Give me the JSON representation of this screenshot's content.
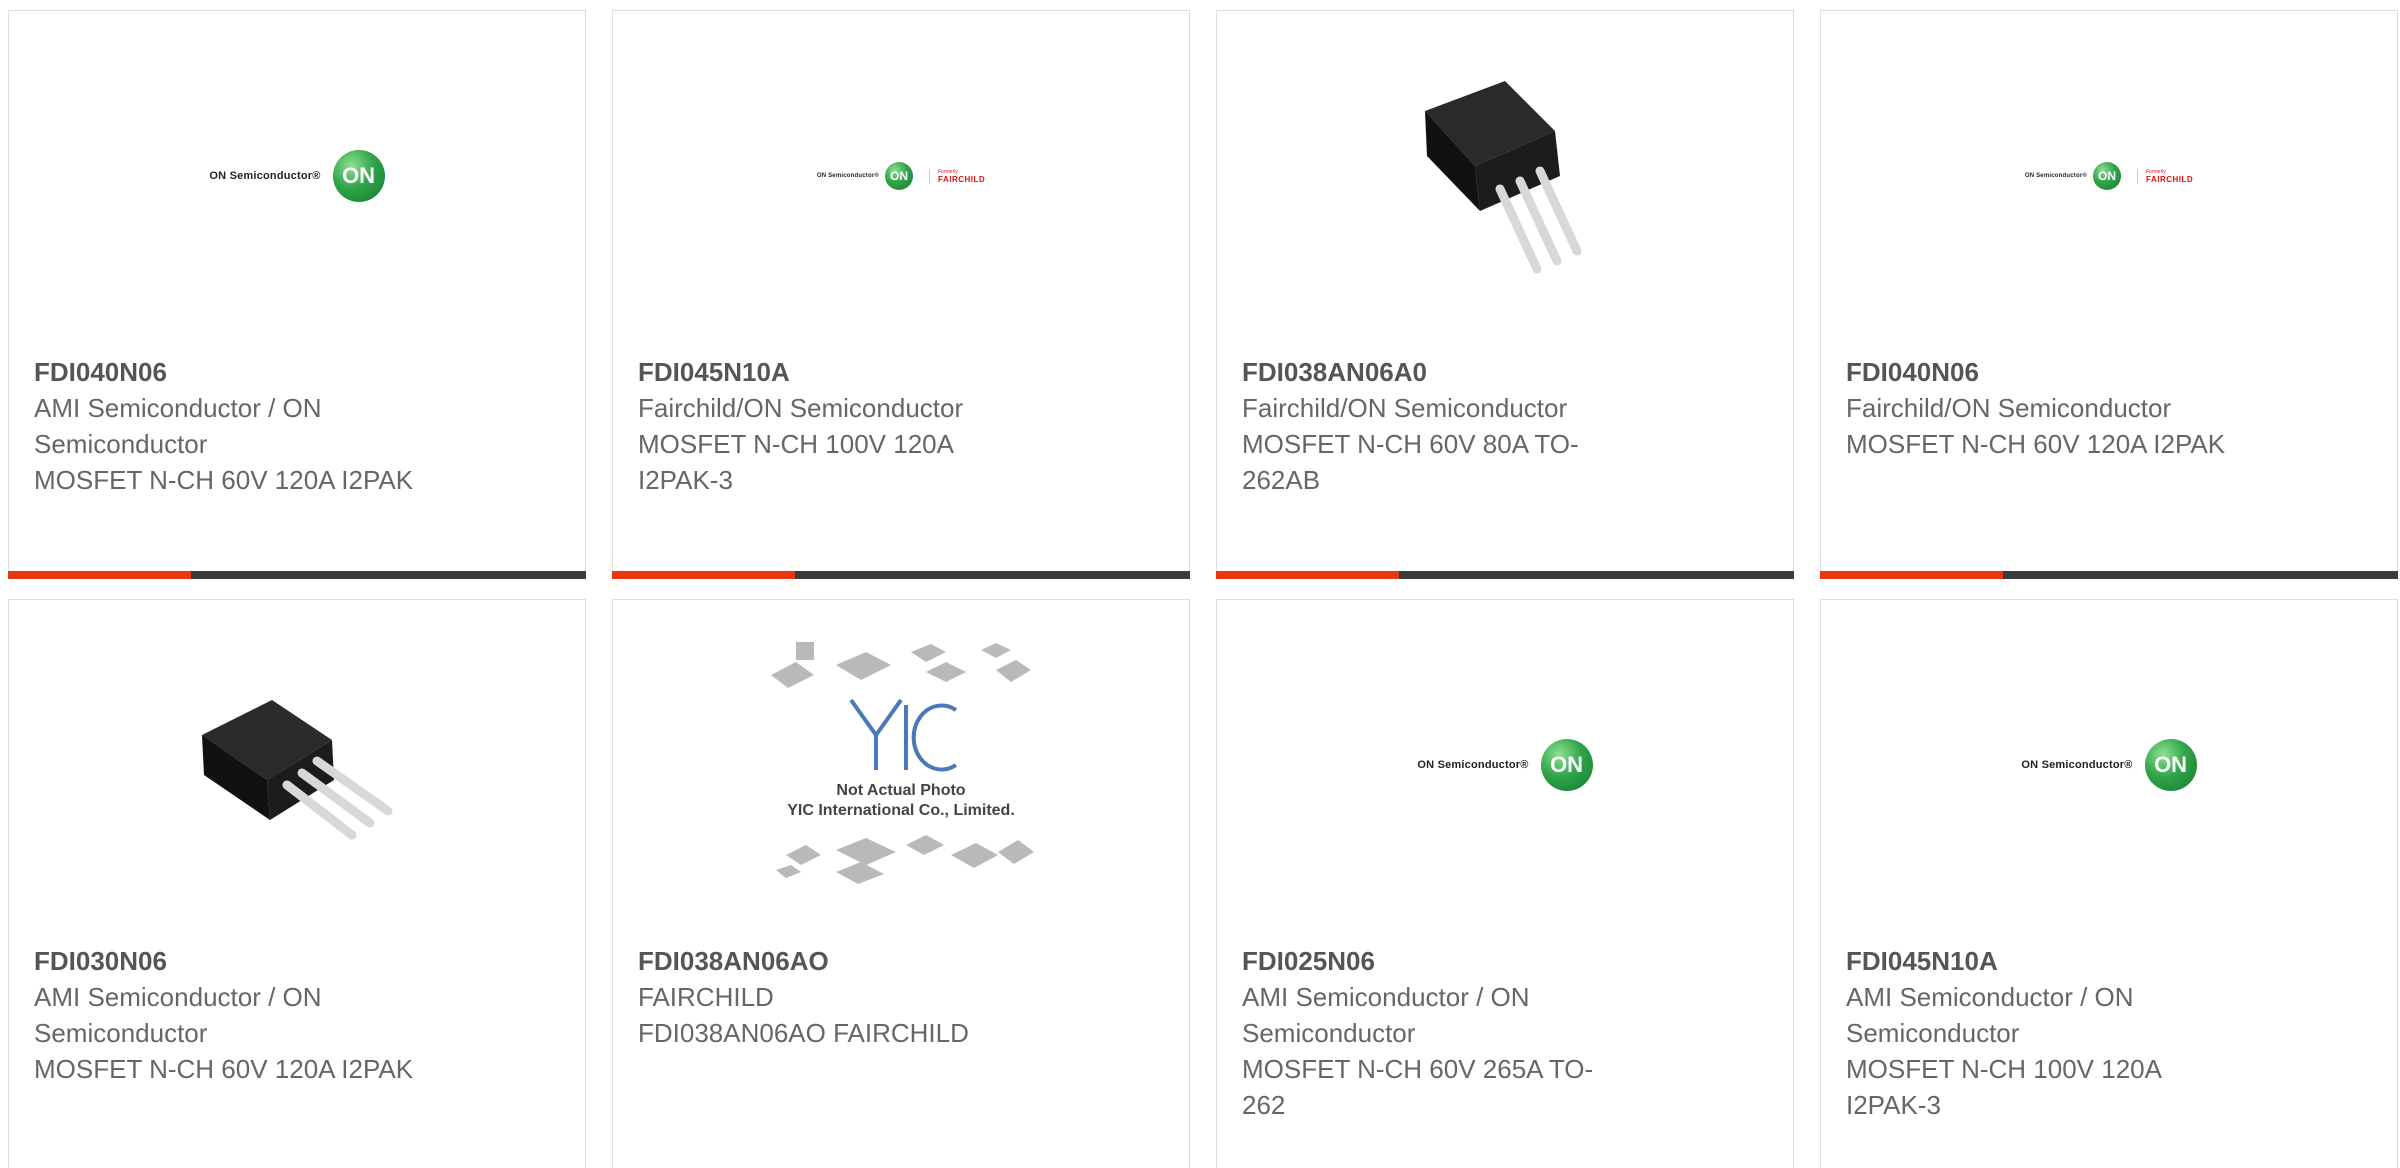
{
  "cards": [
    {
      "part": "FDI040N06",
      "manufacturer_lines": [
        "AMI Semiconductor / ON",
        "Semiconductor"
      ],
      "desc_lines": [
        "MOSFET N-CH 60V 120A I2PAK"
      ],
      "image": "on-semiconductor-logo"
    },
    {
      "part": "FDI045N10A",
      "manufacturer_lines": [
        "Fairchild/ON Semiconductor"
      ],
      "desc_lines": [
        "MOSFET N-CH 100V 120A",
        "I2PAK-3"
      ],
      "image": "on-fairchild-logo"
    },
    {
      "part": "FDI038AN06A0",
      "manufacturer_lines": [
        "Fairchild/ON Semiconductor"
      ],
      "desc_lines": [
        "MOSFET N-CH 60V 80A TO-",
        "262AB"
      ],
      "image": "transistor-photo"
    },
    {
      "part": "FDI040N06",
      "manufacturer_lines": [
        "Fairchild/ON Semiconductor"
      ],
      "desc_lines": [
        "MOSFET N-CH 60V 120A I2PAK"
      ],
      "image": "on-fairchild-logo"
    },
    {
      "part": "FDI030N06",
      "manufacturer_lines": [
        "AMI Semiconductor / ON",
        "Semiconductor"
      ],
      "desc_lines": [
        "MOSFET N-CH 60V 120A I2PAK"
      ],
      "image": "transistor-photo"
    },
    {
      "part": "FDI038AN06AO",
      "manufacturer_lines": [
        "FAIRCHILD"
      ],
      "desc_lines": [
        "FDI038AN06AO FAIRCHILD"
      ],
      "image": "yic-placeholder"
    },
    {
      "part": "FDI025N06",
      "manufacturer_lines": [
        "AMI Semiconductor / ON",
        "Semiconductor"
      ],
      "desc_lines": [
        "MOSFET N-CH 60V 265A TO-",
        "262"
      ],
      "image": "on-semiconductor-logo"
    },
    {
      "part": "FDI045N10A",
      "manufacturer_lines": [
        "AMI Semiconductor / ON",
        "Semiconductor"
      ],
      "desc_lines": [
        "MOSFET N-CH 100V 120A",
        "I2PAK-3"
      ],
      "image": "on-semiconductor-logo"
    }
  ],
  "logos": {
    "on_wordmark": "ON Semiconductor®",
    "on_circle": "ON",
    "formerly_label": "Formerly",
    "fairchild_name": "FAIRCHILD",
    "yic_text_1": "Not Actual Photo",
    "yic_text_2": "YIC International Co., Limited."
  },
  "colors": {
    "accent_orange": "#e8380d",
    "bar_dark": "#3b3b3b",
    "on_green": "#2fa44a",
    "fairchild_red": "#d11111"
  }
}
